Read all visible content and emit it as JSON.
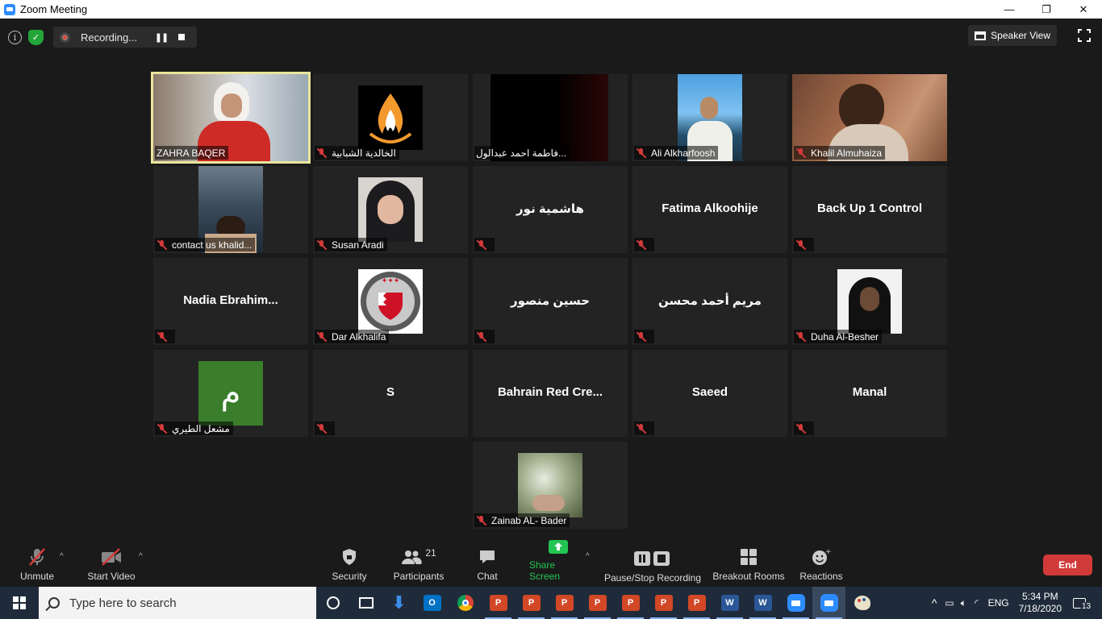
{
  "window": {
    "title": "Zoom Meeting",
    "controls": [
      "—",
      "❐",
      "✕"
    ]
  },
  "topbar": {
    "recording_label": "Recording...",
    "speaker_view_label": "Speaker View"
  },
  "participants": [
    {
      "name": "ZAHRA BAQER",
      "video": "zahra",
      "active": true
    },
    {
      "name": "الخالدية الشبابية",
      "video": "flame",
      "muted": true
    },
    {
      "name": "فاطمة احمد عبدالول...",
      "video": "dark"
    },
    {
      "name": "Ali Alkharfoosh",
      "video": "ali",
      "muted": true
    },
    {
      "name": "Khalil Almuhaiza",
      "video": "khalil",
      "muted": true
    },
    {
      "name": "contact us khalid...",
      "video": "contact",
      "muted": true
    },
    {
      "name": "Susan Aradi",
      "video": "susan",
      "muted": true
    },
    {
      "center_name": "هاشمية نور",
      "muted": true
    },
    {
      "center_name": "Fatima Alkoohije",
      "muted": true
    },
    {
      "center_name": "Back Up 1 Control",
      "muted": true
    },
    {
      "center_name": "Nadia  Ebrahim...",
      "muted": true
    },
    {
      "name": "Dar Alkhalifa",
      "video": "dar",
      "muted": true
    },
    {
      "center_name": "حسين منصور",
      "muted": true
    },
    {
      "center_name": "مريم أحمد محسن",
      "muted": true
    },
    {
      "name": "Duha Al-Besher",
      "video": "duha",
      "muted": true
    },
    {
      "name": "مشعل الطيري",
      "video": "avatar-m",
      "avatar_letter": "م",
      "muted": true
    },
    {
      "center_name": "S",
      "muted": true
    },
    {
      "center_name": "Bahrain Red Cre..."
    },
    {
      "center_name": "Saeed",
      "muted": true
    },
    {
      "center_name": "Manal",
      "muted": true
    },
    {
      "name": "Zainab AL- Bader",
      "video": "zainab",
      "muted": true
    }
  ],
  "toolbar": {
    "unmute": "Unmute",
    "start_video": "Start Video",
    "security": "Security",
    "participants": "Participants",
    "participants_count": "21",
    "chat": "Chat",
    "share_screen": "Share Screen",
    "pause_stop_recording": "Pause/Stop Recording",
    "breakout_rooms": "Breakout Rooms",
    "reactions": "Reactions",
    "end": "End",
    "share_color": "#23c552"
  },
  "taskbar": {
    "search_placeholder": "Type here to search",
    "language": "ENG",
    "time": "5:34 PM",
    "date": "7/18/2020",
    "notification_count": "13"
  }
}
